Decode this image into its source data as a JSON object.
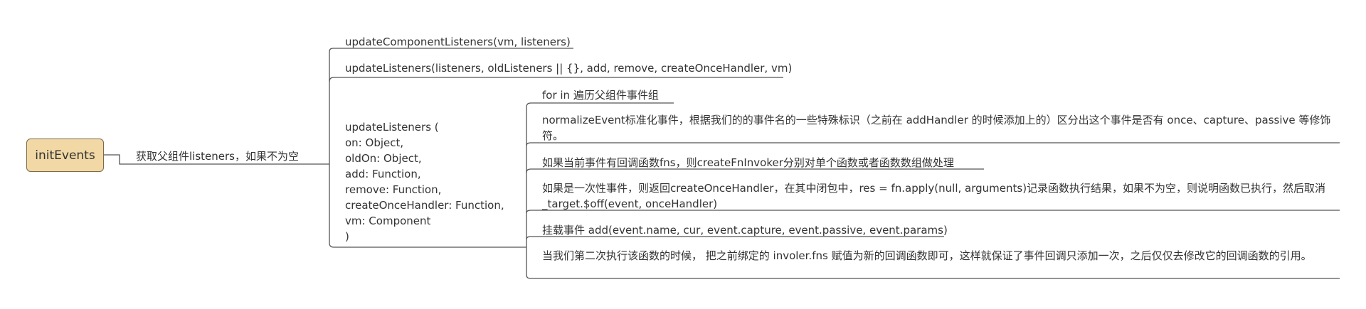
{
  "root": {
    "label": "initEvents"
  },
  "edge_label": "获取父组件listeners，如果不为空",
  "branches": {
    "update_component_listeners": "updateComponentListeners(vm, listeners)",
    "update_listeners_call": "updateListeners(listeners, oldListeners || {}, add, remove, createOnceHandler, vm)",
    "update_listeners_signature": [
      "updateListeners (",
      "on: Object,",
      "oldOn: Object,",
      "add: Function,",
      "remove: Function,",
      "createOnceHandler: Function,",
      "vm: Component",
      ")"
    ]
  },
  "steps": {
    "for_in": "for in 遍历父组件事件组",
    "normalize_event": "normalizeEvent标准化事件，根据我们的的事件名的一些特殊标识（之前在 addHandler 的时候添加上的）区分出这个事件是否有 once、capture、passive 等修饰符。",
    "create_fn_invoker": "如果当前事件有回调函数fns，则createFnInvoker分别对单个函数或者函数数组做处理",
    "once_handler": "如果是一次性事件，则返回createOnceHandler，在其中闭包中，res = fn.apply(null, arguments)记录函数执行结果，如果不为空，则说明函数已执行，然后取消_target.$off(event, onceHandler)",
    "mount_event": "挂载事件 add(event.name, cur, event.capture, event.passive, event.params)",
    "second_run": "当我们第二次执行该函数的时候， 把之前绑定的 involer.fns 赋值为新的回调函数即可，这样就保证了事件回调只添加一次，之后仅仅去修改它的回调函数的引用。"
  },
  "colors": {
    "root_fill": "#f1d8a4",
    "root_border": "#7a6a4d",
    "line": "#555555",
    "text": "#333333"
  }
}
